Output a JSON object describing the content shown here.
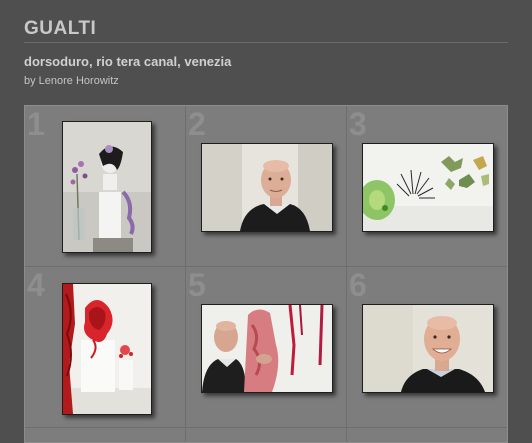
{
  "header": {
    "site_title": "GUALTI",
    "gallery_title": "dorsoduro, rio tera canal, venezia",
    "byline": "by Lenore Horowitz"
  },
  "thumbnails": [
    {
      "number": "1",
      "subject": "mannequin display with purple flowers",
      "orientation": "portrait"
    },
    {
      "number": "2",
      "subject": "portrait of bald man in dark sweater",
      "orientation": "landscape"
    },
    {
      "number": "3",
      "subject": "green leaf-shaped jewelry on white wall",
      "orientation": "landscape"
    },
    {
      "number": "4",
      "subject": "red sculptural jewelry display",
      "orientation": "portrait"
    },
    {
      "number": "5",
      "subject": "man beside red hanging sculptures",
      "orientation": "landscape"
    },
    {
      "number": "6",
      "subject": "smiling bald man portrait",
      "orientation": "landscape"
    }
  ]
}
